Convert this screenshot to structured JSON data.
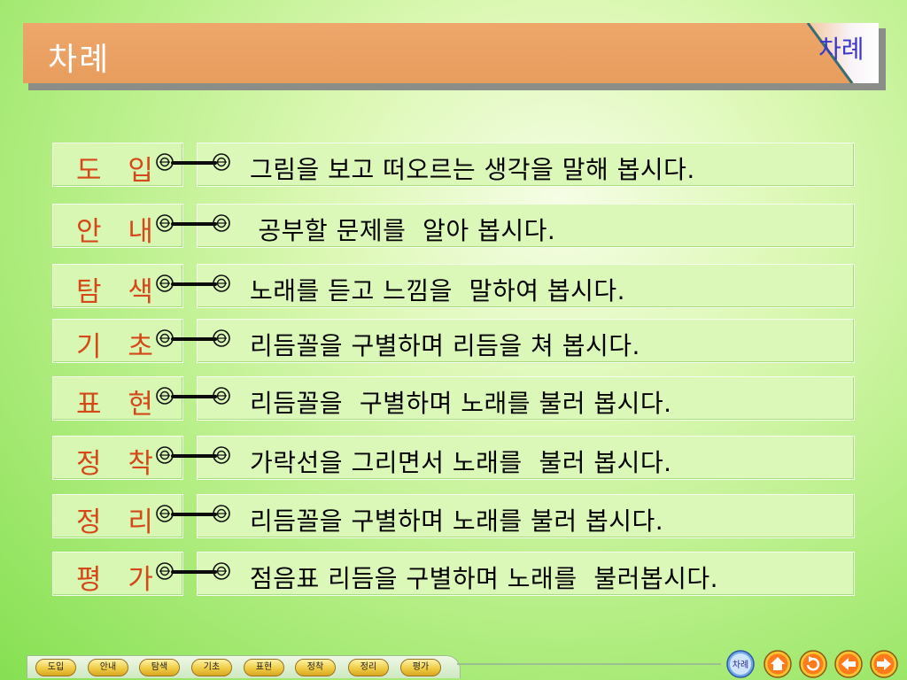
{
  "title": "차례",
  "corner_label": "차례",
  "rows": [
    {
      "category": "도 입",
      "description": "그림을 보고 떠오르는 생각을 말해 봅시다."
    },
    {
      "category": "안 내",
      "description": " 공부할 문제를  알아 봅시다."
    },
    {
      "category": "탐 색",
      "description": "노래를 듣고 느낌을  말하여 봅시다."
    },
    {
      "category": "기 초",
      "description": "리듬꼴을 구별하며 리듬을 쳐 봅시다."
    },
    {
      "category": "표 현",
      "description": "리듬꼴을  구별하며 노래를 불러 봅시다."
    },
    {
      "category": "정 착",
      "description": "가락선을 그리면서 노래를  불러 봅시다."
    },
    {
      "category": "정 리",
      "description": "리듬꼴을 구별하며 노래를 불러 봅시다."
    },
    {
      "category": "평 가",
      "description": "점음표 리듬을 구별하며 노래를  불러봅시다."
    }
  ],
  "bottom_nav": [
    "도입",
    "안내",
    "탐색",
    "기초",
    "표현",
    "정착",
    "정리",
    "평가"
  ],
  "controls": {
    "toc": "차례",
    "home": "home-icon",
    "replay": "replay-icon",
    "prev": "arrow-left-icon",
    "next": "arrow-right-icon"
  },
  "colors": {
    "title_bar": "#e9a060",
    "category_text": "#d4481a",
    "corner_text": "#3b38c9",
    "row_box": "#dbf8b8",
    "nav_button": "#f0cc44"
  }
}
